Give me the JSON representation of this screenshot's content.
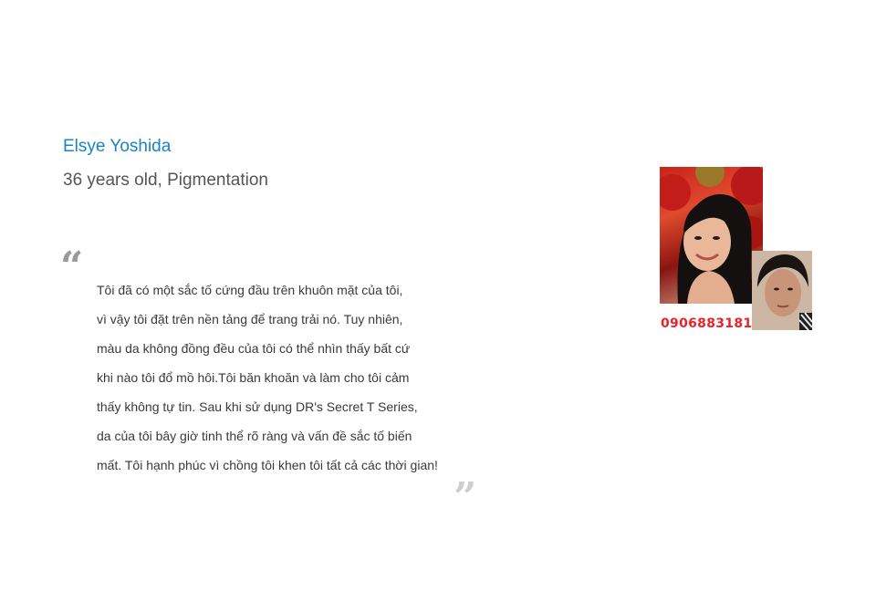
{
  "testimonial": {
    "name": "Elsye Yoshida",
    "subtitle": "36 years old, Pigmentation",
    "quote_open": "“",
    "quote_close": "”",
    "lines": [
      "Tôi đã có một sắc tố cứng đầu trên khuôn mặt của tôi,",
      "vì vậy tôi đặt trên nền tảng để trang trải nó. Tuy nhiên,",
      "màu da không đồng đều của tôi có thể nhìn thấy bất cứ",
      "khi nào tôi đổ mồ hôi.Tôi băn khoăn và làm cho tôi cảm",
      "thấy không tự tin. Sau khi sử dụng DR's Secret T Series,",
      "da của tôi bây giờ tinh thể rõ ràng và vấn đề sắc tố biến",
      "mất. Tôi hạnh phúc vì chồng tôi khen tôi tất cả các thời gian!"
    ]
  },
  "photos": {
    "phone_overlay": "0906883181"
  }
}
